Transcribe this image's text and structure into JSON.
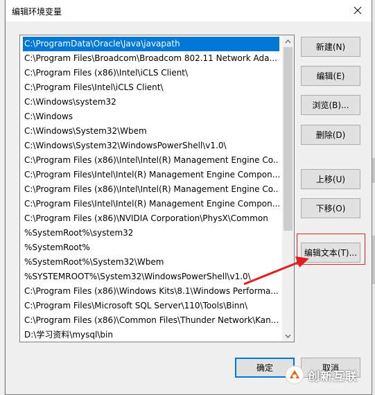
{
  "dialog": {
    "title": "编辑环境变量",
    "close_icon": "close-icon"
  },
  "path_list": {
    "selected_index": 0,
    "items": [
      "C:\\ProgramData\\Oracle\\Java\\javapath",
      "C:\\Program Files\\Broadcom\\Broadcom 802.11 Network Ada...",
      "C:\\Program Files (x86)\\Intel\\iCLS Client\\",
      "C:\\Program Files\\Intel\\iCLS Client\\",
      "C:\\Windows\\system32",
      "C:\\Windows",
      "C:\\Windows\\System32\\Wbem",
      "C:\\Windows\\System32\\WindowsPowerShell\\v1.0\\",
      "C:\\Program Files (x86)\\Intel\\Intel(R) Management Engine Co...",
      "C:\\Program Files\\Intel\\Intel(R) Management Engine Compon...",
      "C:\\Program Files (x86)\\Intel\\Intel(R) Management Engine Co...",
      "C:\\Program Files\\Intel\\Intel(R) Management Engine Compon...",
      "C:\\Program Files (x86)\\NVIDIA Corporation\\PhysX\\Common",
      "%SystemRoot%\\system32",
      "%SystemRoot%",
      "%SystemRoot%\\System32\\Wbem",
      "%SYSTEMROOT%\\System32\\WindowsPowerShell\\v1.0\\",
      "C:\\Program Files (x86)\\Windows Kits\\8.1\\Windows Performa...",
      "C:\\Program Files\\Microsoft SQL Server\\110\\Tools\\Binn\\",
      "C:\\Program Files (x86)\\Common Files\\Thunder Network\\Kan...",
      "D:\\学习资料\\mysql\\bin"
    ]
  },
  "buttons": {
    "new": "新建(N)",
    "edit": "编辑(E)",
    "browse": "浏览(B)...",
    "delete": "删除(D)",
    "move_up": "上移(U)",
    "move_down": "下移(O)",
    "edit_text": "编辑文本(T)...",
    "ok": "确定",
    "cancel": "取消"
  },
  "annotation": {
    "highlight_color": "#e02020"
  },
  "watermark": {
    "text": "创新互联"
  },
  "colors": {
    "selection": "#0078d7",
    "button_bg": "#e1e1e1",
    "dialog_bg": "#f0f0f0"
  }
}
